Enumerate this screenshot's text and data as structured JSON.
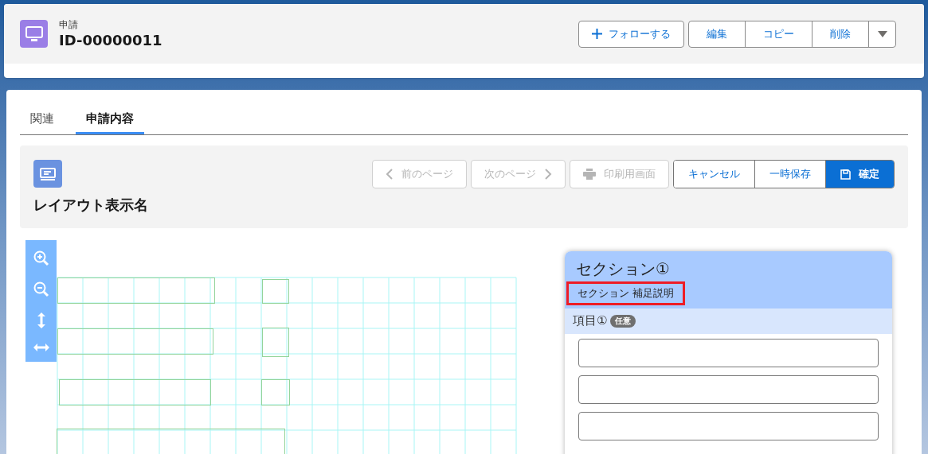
{
  "record": {
    "object_label": "申請",
    "name": "ID-00000011"
  },
  "header_actions": {
    "follow": "フォローする",
    "buttons": [
      "編集",
      "コピー",
      "削除"
    ]
  },
  "tabs": [
    {
      "label": "関連",
      "selected": false
    },
    {
      "label": "申請内容",
      "selected": true
    }
  ],
  "layout": {
    "title": "レイアウト表示名",
    "nav_buttons": [
      {
        "label": "前のページ",
        "kind": "prev",
        "disabled": true
      },
      {
        "label": "次のページ",
        "kind": "next",
        "disabled": true
      },
      {
        "label": "印刷用画面",
        "kind": "print",
        "disabled": true
      }
    ],
    "actions": [
      {
        "label": "キャンセル",
        "kind": "plain"
      },
      {
        "label": "一時保存",
        "kind": "plain"
      },
      {
        "label": "確定",
        "kind": "primary"
      }
    ]
  },
  "section": {
    "title": "セクション①",
    "description": "セクション 補足説明",
    "highlighted": true,
    "item": {
      "label": "項目①",
      "badge": "任意"
    },
    "fields": [
      {
        "kind": "text"
      },
      {
        "kind": "text"
      },
      {
        "kind": "text"
      }
    ]
  }
}
